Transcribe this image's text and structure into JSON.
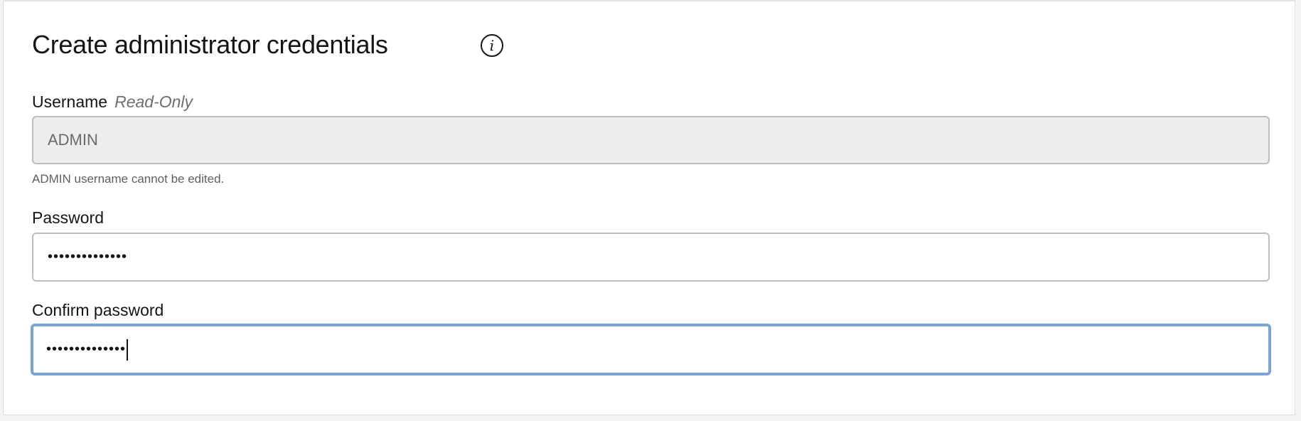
{
  "section": {
    "title": "Create administrator credentials",
    "info_icon": "i"
  },
  "username": {
    "label": "Username",
    "readonly_tag": "Read-Only",
    "value": "ADMIN",
    "help": "ADMIN username cannot be edited."
  },
  "password": {
    "label": "Password",
    "masked_value": "••••••••••••••"
  },
  "confirm_password": {
    "label": "Confirm password",
    "masked_value": "••••••••••••••"
  },
  "colors": {
    "focus_border": "#78a4d8",
    "disabled_bg": "#ededed"
  }
}
